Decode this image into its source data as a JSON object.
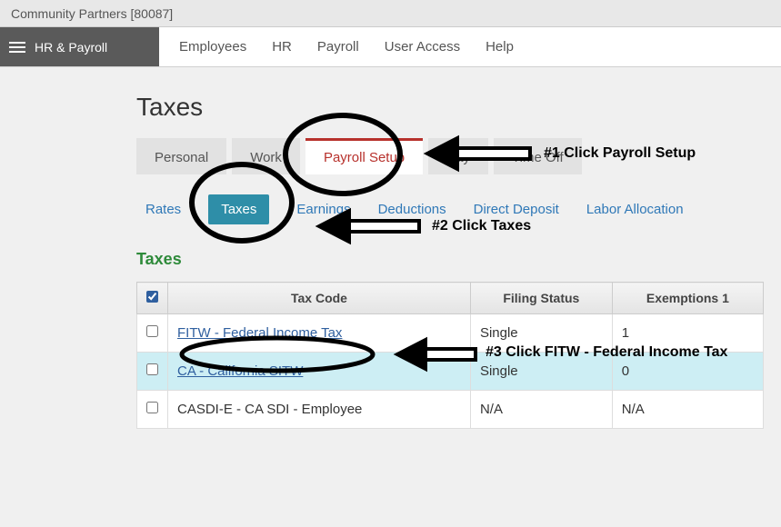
{
  "titlebar": "Community Partners [80087]",
  "sidebar": {
    "title": "HR & Payroll"
  },
  "nav": {
    "employees": "Employees",
    "hr": "HR",
    "payroll": "Payroll",
    "user_access": "User Access",
    "help": "Help"
  },
  "page_title": "Taxes",
  "tabs": {
    "personal": "Personal",
    "work": "Work",
    "payroll_setup": "Payroll Setup",
    "pay": "Pay",
    "time_off": "Time Off",
    "active": "payroll_setup"
  },
  "subtabs": {
    "rates": "Rates",
    "taxes": "Taxes",
    "earnings": "Earnings",
    "deductions": "Deductions",
    "direct_deposit": "Direct Deposit",
    "labor_allocation": "Labor Allocation",
    "active": "taxes"
  },
  "section_title": "Taxes",
  "table": {
    "headers": {
      "tax_code": "Tax Code",
      "filing_status": "Filing Status",
      "exemptions1": "Exemptions 1"
    },
    "rows": [
      {
        "tax_code": "FITW - Federal Income Tax",
        "filing_status": "Single",
        "exemptions": "1",
        "link": true,
        "highlight": false
      },
      {
        "tax_code": "CA - California SITW",
        "filing_status": "Single",
        "exemptions": "0",
        "link": true,
        "highlight": true
      },
      {
        "tax_code": "CASDI-E - CA SDI - Employee",
        "filing_status": "N/A",
        "exemptions": "N/A",
        "link": false,
        "highlight": false
      }
    ]
  },
  "annotations": {
    "a1": "#1 Click Payroll Setup",
    "a2": "#2 Click Taxes",
    "a3": "#3 Click FITW - Federal Income Tax"
  }
}
